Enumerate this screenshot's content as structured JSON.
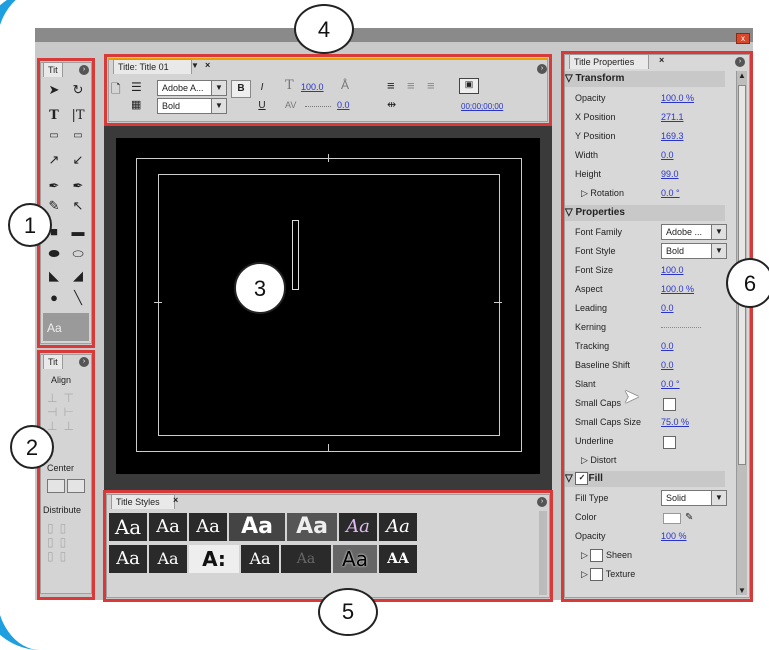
{
  "window": {
    "close_glyph": "x"
  },
  "callouts": [
    "1",
    "2",
    "3",
    "4",
    "5",
    "6"
  ],
  "tools_panel": {
    "tab": "Tit",
    "tools": [
      "selection-icon",
      "rotate-icon",
      "type-icon",
      "vertical-type-icon",
      "area-type-icon",
      "vertical-area-type-icon",
      "path-type-icon",
      "vertical-path-type-icon",
      "pen-icon",
      "add-anchor-icon",
      "delete-anchor-icon",
      "convert-anchor-icon",
      "rectangle-icon",
      "rounded-rect-icon",
      "clipped-rect-icon",
      "rounded-corner-rect-icon",
      "wedge-icon",
      "arc-icon",
      "ellipse-icon",
      "line-icon"
    ],
    "preview": "Aa"
  },
  "actions_panel": {
    "tab": "Tit",
    "align_label": "Align",
    "center_label": "Center",
    "distribute_label": "Distribute"
  },
  "toolbar": {
    "tab": "Title: Title 01",
    "font_family": "Adobe A...",
    "font_style": "Bold",
    "bold": "B",
    "italic": "I",
    "underline": "U",
    "font_size": "100.0",
    "kerning": "0.0",
    "timecode": "00;00;00;00"
  },
  "styles_panel": {
    "tab": "Title Styles",
    "row1": [
      "Aa",
      "Aa",
      "Aa",
      "Aa",
      "Aa",
      "Aa",
      "Aa"
    ],
    "row2": [
      "Aa",
      "Aa",
      "A:",
      "Aa",
      "Aa",
      "Aa",
      "AA"
    ]
  },
  "properties": {
    "tab": "Title Properties",
    "transform_label": "Transform",
    "opacity_label": "Opacity",
    "opacity": "100.0 %",
    "xpos_label": "X Position",
    "xpos": "271.1",
    "ypos_label": "Y Position",
    "ypos": "169.3",
    "width_label": "Width",
    "width": "0.0",
    "height_label": "Height",
    "height": "99.0",
    "rotation_label": "Rotation",
    "rotation": "0.0 °",
    "properties_label": "Properties",
    "font_family_label": "Font Family",
    "font_family": "Adobe ...",
    "font_style_label": "Font Style",
    "font_style": "Bold",
    "font_size_label": "Font Size",
    "font_size": "100.0",
    "aspect_label": "Aspect",
    "aspect": "100.0 %",
    "leading_label": "Leading",
    "leading": "0.0",
    "kerning_label": "Kerning",
    "tracking_label": "Tracking",
    "tracking": "0.0",
    "baseline_label": "Baseline Shift",
    "baseline": "0.0",
    "slant_label": "Slant",
    "slant": "0.0 °",
    "smallcaps_label": "Small Caps",
    "smallcaps_size_label": "Small Caps Size",
    "smallcaps_size": "75.0 %",
    "underline_label": "Underline",
    "distort_label": "Distort",
    "fill_label": "Fill",
    "fill_type_label": "Fill Type",
    "fill_type": "Solid",
    "color_label": "Color",
    "fill_opacity_label": "Opacity",
    "fill_opacity": "100 %",
    "sheen_label": "Sheen",
    "texture_label": "Texture"
  }
}
